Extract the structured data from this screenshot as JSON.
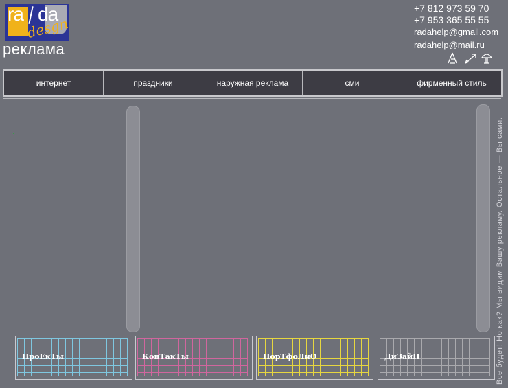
{
  "logo": {
    "top_left": "ra",
    "top_right": "da",
    "script": "desgn",
    "subtitle": "реклама"
  },
  "contacts": {
    "phone1": "+7 812 973 59 70",
    "phone2": "+7 953 365 55 55",
    "email1": "radahelp@gmail.com",
    "email2": "radahelp@mail.ru"
  },
  "mini_icons": [
    "tent-icon",
    "arrow-icon",
    "mushroom-icon"
  ],
  "nav": {
    "items": [
      {
        "label": "интернет"
      },
      {
        "label": "праздники"
      },
      {
        "label": "наружная реклама"
      },
      {
        "label": "сми"
      },
      {
        "label": "фирменный стиль"
      }
    ]
  },
  "slogan": "Все будет! Но как? Мы видим Вашу рекламу. Остальное — Вы сами.",
  "tiles": [
    {
      "label": "ПроЕкТы",
      "color": "#7fc7e0"
    },
    {
      "label": "КонТакТы",
      "color": "#d0669e"
    },
    {
      "label": "ПорТфоЛиО",
      "color": "#e6d640"
    },
    {
      "label": "ДиЗайН",
      "color": "#a9a9ad"
    }
  ],
  "colors": {
    "background": "#6e7078",
    "nav_bg": "#3d3c44",
    "logo_blue": "#2b3496",
    "logo_yellow": "#f0b21a"
  }
}
